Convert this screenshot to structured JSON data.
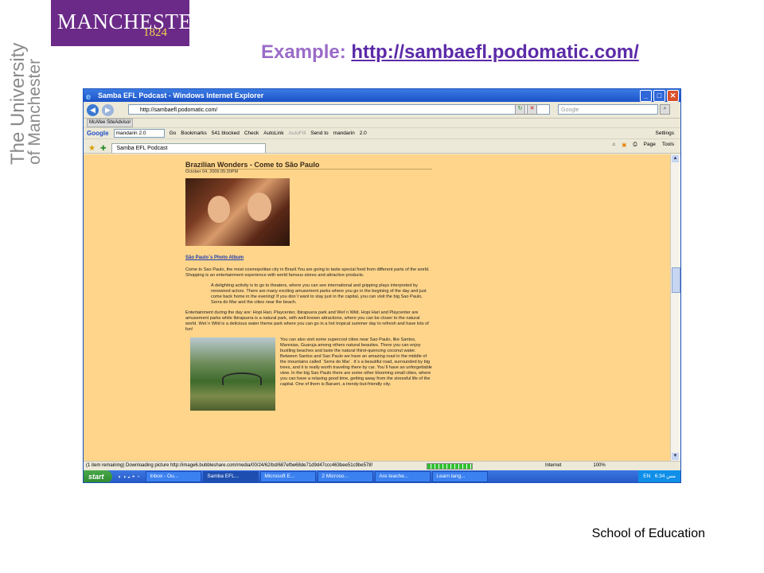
{
  "logo": {
    "name": "MANCHESTER",
    "year": "1824"
  },
  "side_text": [
    "The University",
    "of Manchester"
  ],
  "slide_title": {
    "prefix": "Example: ",
    "link": "http://sambaefl.podomatic.com/"
  },
  "footer": "School of Education",
  "browser": {
    "title": "Samba EFL Podcast - Windows Internet Explorer",
    "address": "http://sambaefl.podomatic.com/",
    "search_placeholder": "Google",
    "mcafee": "McAfee SiteAdvisor",
    "google_bar": {
      "logo": "Google",
      "query": "mandarin 2.0",
      "items": [
        "Go",
        "Bookmarks",
        "541 blocked",
        "Check",
        "AutoLink",
        "AutoFill",
        "Send to",
        "mandarin",
        "2.0",
        "Settings"
      ]
    },
    "tab": "Samba EFL Podcast",
    "right_tools": [
      "Page",
      "Tools"
    ],
    "status": "(1 item remaining) Downloading picture http://image6.bubbleshare.com/media/00/24/62/bd/687efbe68de71d9d47ccc463bee51c9be578!",
    "zone": "Internet",
    "zoom": "100%",
    "taskbar": {
      "start": "start",
      "items": [
        "Inbox - Ou...",
        "Samba EFL...",
        "Microsoft E...",
        "2 Microso...",
        "Are teache...",
        "Learn lang..."
      ],
      "lang": "EN",
      "time": "6:34 مس"
    }
  },
  "post": {
    "title": "Brazilian Wonders - Come to São Paulo",
    "date": "October 04, 2006 05:30PM",
    "album_link": "São Paulo´s Photo Album",
    "paragraphs": [
      "Come to Sao Paulo, the most cosmopolitan city in Brazil.You are going to taste special food from different parts of the world. Shopping is an entertainment experience with world famous stores and attractive products.",
      "A delighting activity is to go to theaters, where you can see international and gripping plays interpreted by renowned actors. There are many exciting amusement parks where you go in the begining of the day and just come back home in the evening! If you don´t want to stay just in the capital, you can visit the big Sao Paulo, Serra do Mar and the cities near the beach.",
      "Entertainment during the day are: Hopi Hari, Playcenter, Ibirapuera park and Wet´n Wild. Hopi Hari and Playcenter are amusement parks while Ibirapuera is a natural park, with well-known attractions, where you can be closer to the natural world. Wet´n Wild is a delicious water theme park where you can go in a hot tropical summer day to refresh and have lots of fun!",
      "You can also visit some supercool cities near Sao Paulo, like Santos, Maresias, Guaruja among others natural beauties. There you can enjoy bustling beaches and taste the natural thirst-quencing coconut water. Between Santos and Sao Paulo we have an amazing road in the middle of the mountains called ´Serra do Mar´. It´s a beautiful road, surrounded by big trees, and it is really worth traveling there by car. You´ll have an unforgettable view. In the big Sao Paulo there are some other blooming small cities, where you can have a relaxing good time, getting away from the stressful life of the capital. One of them is Barueri, a trendy-but-friendly city."
    ]
  }
}
